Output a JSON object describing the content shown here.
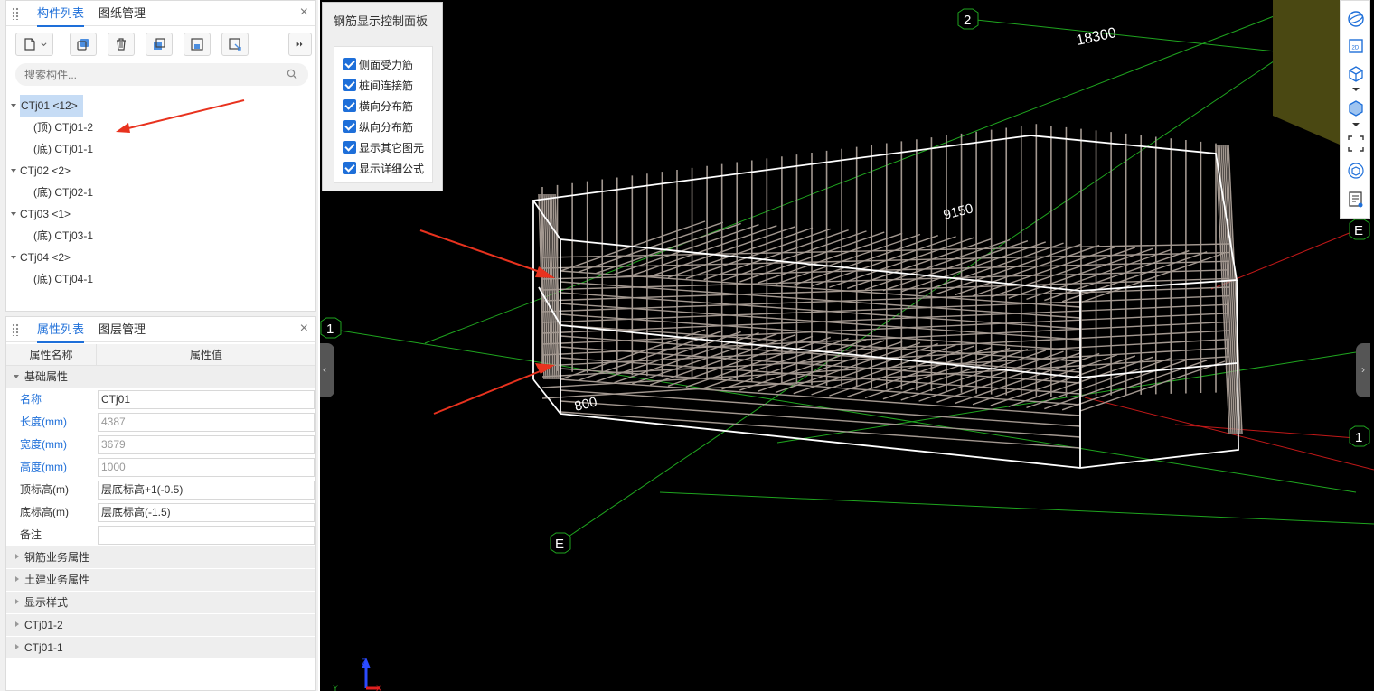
{
  "component_panel": {
    "tabs": [
      {
        "label": "构件列表"
      },
      {
        "label": "图纸管理"
      }
    ],
    "close_glyph": "×",
    "toolbar_icons": [
      "new-component-icon",
      "copy-icon",
      "delete-icon",
      "duplicate-icon",
      "save-layer-icon",
      "export-icon",
      "more-icon"
    ],
    "search_placeholder": "搜索构件...",
    "tree": [
      {
        "label": "CTj01 <12>",
        "selected": true,
        "children": [
          {
            "label": "(顶)  CTj01-2"
          },
          {
            "label": "(底)  CTj01-1"
          }
        ]
      },
      {
        "label": "CTj02 <2>",
        "children": [
          {
            "label": "(底)  CTj02-1"
          }
        ]
      },
      {
        "label": "CTj03 <1>",
        "children": [
          {
            "label": "(底)  CTj03-1"
          }
        ]
      },
      {
        "label": "CTj04 <2>",
        "children": [
          {
            "label": "(底)  CTj04-1"
          }
        ]
      }
    ]
  },
  "property_panel": {
    "tabs": [
      {
        "label": "属性列表"
      },
      {
        "label": "图层管理"
      }
    ],
    "close_glyph": "×",
    "col_name": "属性名称",
    "col_value": "属性值",
    "section_basic": "基础属性",
    "rows": [
      {
        "name": "名称",
        "value": "CTj01",
        "blue": true,
        "editable": true
      },
      {
        "name": "长度(mm)",
        "value": "4387",
        "blue": true,
        "editable": false
      },
      {
        "name": "宽度(mm)",
        "value": "3679",
        "blue": true,
        "editable": false
      },
      {
        "name": "高度(mm)",
        "value": "1000",
        "blue": true,
        "editable": false
      },
      {
        "name": "顶标高(m)",
        "value": "层底标高+1(-0.5)",
        "blue": false,
        "editable": true
      },
      {
        "name": "底标高(m)",
        "value": "层底标高(-1.5)",
        "blue": false,
        "editable": true
      },
      {
        "name": "备注",
        "value": "",
        "blue": false,
        "editable": true
      }
    ],
    "collapsed_sections": [
      "钢筋业务属性",
      "土建业务属性",
      "显示样式",
      "CTj01-2",
      "CTj01-1"
    ]
  },
  "rebar_control": {
    "title": "钢筋显示控制面板",
    "options": [
      {
        "label": "侧面受力筋",
        "checked": true
      },
      {
        "label": "桩间连接筋",
        "checked": true
      },
      {
        "label": "横向分布筋",
        "checked": true
      },
      {
        "label": "纵向分布筋",
        "checked": true
      },
      {
        "label": "显示其它图元",
        "checked": true
      },
      {
        "label": "显示详细公式",
        "checked": true
      }
    ]
  },
  "viewport": {
    "axis_labels": [
      "2",
      "1",
      "E",
      "E",
      "1"
    ],
    "dimensions": [
      "18300",
      "9150",
      "800"
    ],
    "axis_letters": [
      "Z",
      "Y",
      "X"
    ],
    "colors": {
      "grid_green": "#1fa51f",
      "grid_red": "#c01818",
      "rebar": "#a39890",
      "arrow": "#e8321e",
      "wireframe": "#ffffff"
    }
  },
  "right_toolbar_icons": [
    "orbit-icon",
    "2d-view-icon",
    "3d-box-icon",
    "dropdown-icon",
    "3d-solid-icon",
    "dropdown-icon",
    "fit-view-icon",
    "section-box-icon",
    "display-list-icon"
  ]
}
